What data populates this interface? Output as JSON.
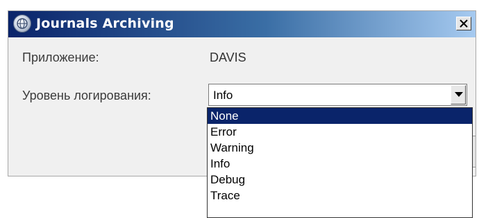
{
  "window": {
    "title": "Journals Archiving",
    "accent": "#0a246a"
  },
  "form": {
    "app_label": "Приложение:",
    "app_value": "DAVIS",
    "level_label": "Уровень логирования:",
    "level_selected": "Info"
  },
  "dropdown": {
    "options": [
      "None",
      "Error",
      "Warning",
      "Info",
      "Debug",
      "Trace"
    ],
    "highlighted": "None"
  },
  "icons": {
    "title": "app-globe-icon",
    "close": "close-icon",
    "arrow": "chevron-down-icon"
  }
}
